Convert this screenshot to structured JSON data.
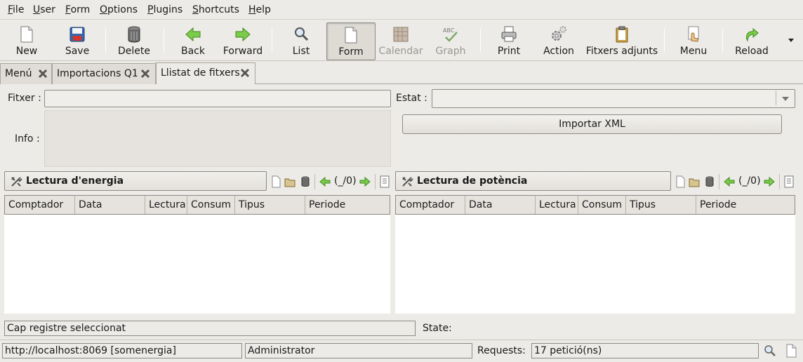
{
  "menubar": {
    "items": [
      "File",
      "User",
      "Form",
      "Options",
      "Plugins",
      "Shortcuts",
      "Help"
    ]
  },
  "toolbar": {
    "buttons": [
      {
        "label": "New",
        "icon": "new-document-icon",
        "enabled": true
      },
      {
        "label": "Save",
        "icon": "floppy-disk-icon",
        "enabled": true
      },
      {
        "label": "Delete",
        "icon": "trash-can-icon",
        "enabled": true
      },
      {
        "label": "Back",
        "icon": "arrow-left-icon",
        "enabled": true
      },
      {
        "label": "Forward",
        "icon": "arrow-right-icon",
        "enabled": true
      },
      {
        "label": "List",
        "icon": "magnifier-icon",
        "enabled": true
      },
      {
        "label": "Form",
        "icon": "form-document-icon",
        "enabled": true,
        "active": true
      },
      {
        "label": "Calendar",
        "icon": "calendar-icon",
        "enabled": false
      },
      {
        "label": "Graph",
        "icon": "spell-check-graph-icon",
        "enabled": false
      },
      {
        "label": "Print",
        "icon": "printer-icon",
        "enabled": true
      },
      {
        "label": "Action",
        "icon": "gears-icon",
        "enabled": true
      },
      {
        "label": "Fitxers adjunts",
        "icon": "clipboard-icon",
        "enabled": true
      },
      {
        "label": "Menu",
        "icon": "hand-menu-icon",
        "enabled": true
      },
      {
        "label": "Reload",
        "icon": "reload-arrow-icon",
        "enabled": true
      }
    ],
    "overflow_icon": "dropdown-arrow-icon"
  },
  "tabs": [
    {
      "label": "Menú",
      "active": false
    },
    {
      "label": "Importacions Q1",
      "active": false
    },
    {
      "label": "Llistat de fitxers",
      "active": true
    }
  ],
  "form": {
    "fitxer_label": "Fitxer :",
    "fitxer_value": "",
    "estat_label": "Estat :",
    "estat_value": "",
    "info_label": "Info :",
    "info_value": "",
    "import_button": "Importar XML"
  },
  "panels": [
    {
      "title": "Lectura d'energia",
      "pager": "(_/0)",
      "columns": [
        "Comptador",
        "Data",
        "Lectura",
        "Consum",
        "Tipus",
        "Periode"
      ],
      "rows": []
    },
    {
      "title": "Lectura de potència",
      "pager": "(_/0)",
      "columns": [
        "Comptador",
        "Data",
        "Lectura",
        "Consum",
        "Tipus",
        "Periode"
      ],
      "rows": []
    }
  ],
  "record_status": {
    "message": "Cap registre seleccionat",
    "state_label": "State:",
    "state_value": ""
  },
  "statusbar": {
    "server": "http://localhost:8069 [somenergia]",
    "user": "Administrator",
    "requests_label": "Requests:",
    "requests_value": "17 petició(ns)"
  },
  "colors": {
    "background": "#edebe7",
    "green_arrow": "#5fb43a",
    "grid_body": "#ffffff"
  }
}
